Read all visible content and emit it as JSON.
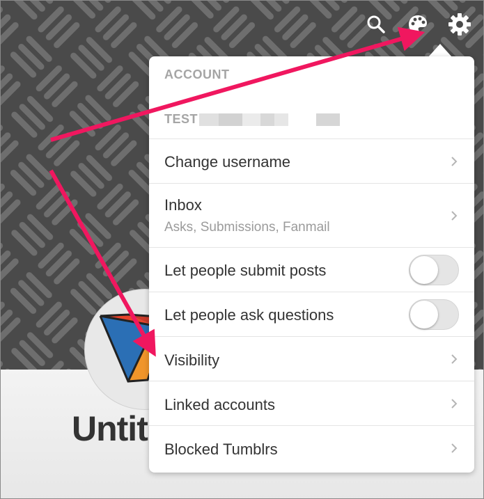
{
  "header": {
    "icons": [
      "search-icon",
      "palette-icon",
      "gear-icon"
    ]
  },
  "blog": {
    "title": "Untit"
  },
  "menu": {
    "account_header": "ACCOUNT",
    "account_name": "TEST",
    "items": [
      {
        "label": "Change username",
        "type": "chevron"
      },
      {
        "label": "Inbox",
        "sublabel": "Asks, Submissions, Fanmail",
        "type": "chevron"
      },
      {
        "label": "Let people submit posts",
        "type": "toggle",
        "checked": false
      },
      {
        "label": "Let people ask questions",
        "type": "toggle",
        "checked": false
      },
      {
        "label": "Visibility",
        "type": "chevron"
      },
      {
        "label": "Linked accounts",
        "type": "chevron"
      },
      {
        "label": "Blocked Tumblrs",
        "type": "chevron"
      }
    ]
  },
  "colors": {
    "annotation_arrow": "#f0175f",
    "header_bg": "#4a4a4a",
    "text_primary": "#333333",
    "text_muted": "#9b9b9b"
  }
}
